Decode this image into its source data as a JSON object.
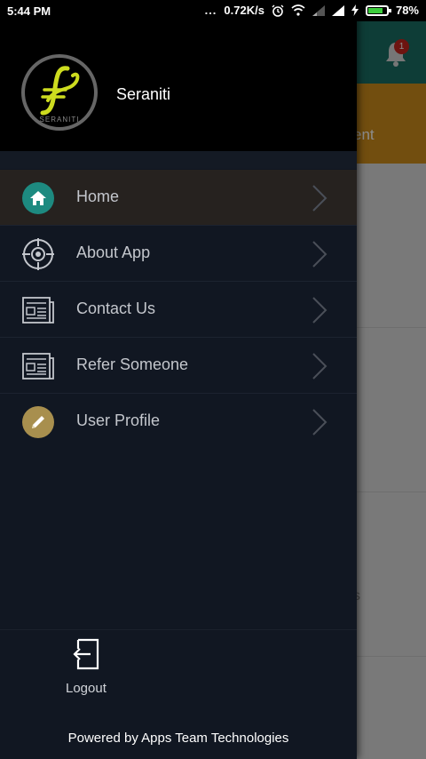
{
  "status_bar": {
    "time": "5:44 PM",
    "dots": "...",
    "speed": "0.72K/s",
    "battery": "78%",
    "battery_level": 0.78
  },
  "background": {
    "notification_count": "1",
    "banner_text_fragment": "ent",
    "row_text_fragment": "s"
  },
  "drawer": {
    "brand_name": "Seraniti",
    "logo_caption": "SERANITI",
    "items": [
      {
        "label": "Home",
        "icon": "home-icon",
        "icon_bg": "#1d8a80"
      },
      {
        "label": "About App",
        "icon": "target-icon"
      },
      {
        "label": "Contact Us",
        "icon": "newspaper-icon"
      },
      {
        "label": "Refer Someone",
        "icon": "newspaper-icon"
      },
      {
        "label": "User Profile",
        "icon": "pencil-icon",
        "icon_bg": "#a88f4e"
      }
    ],
    "logout_label": "Logout",
    "powered_by": "Powered by Apps Team Technologies"
  },
  "colors": {
    "drawer_bg": "#111722",
    "active_item_bg": "#26221f",
    "appbar": "#1b6f65",
    "banner": "#d08f1c",
    "logo_accent": "#cddc1f"
  }
}
